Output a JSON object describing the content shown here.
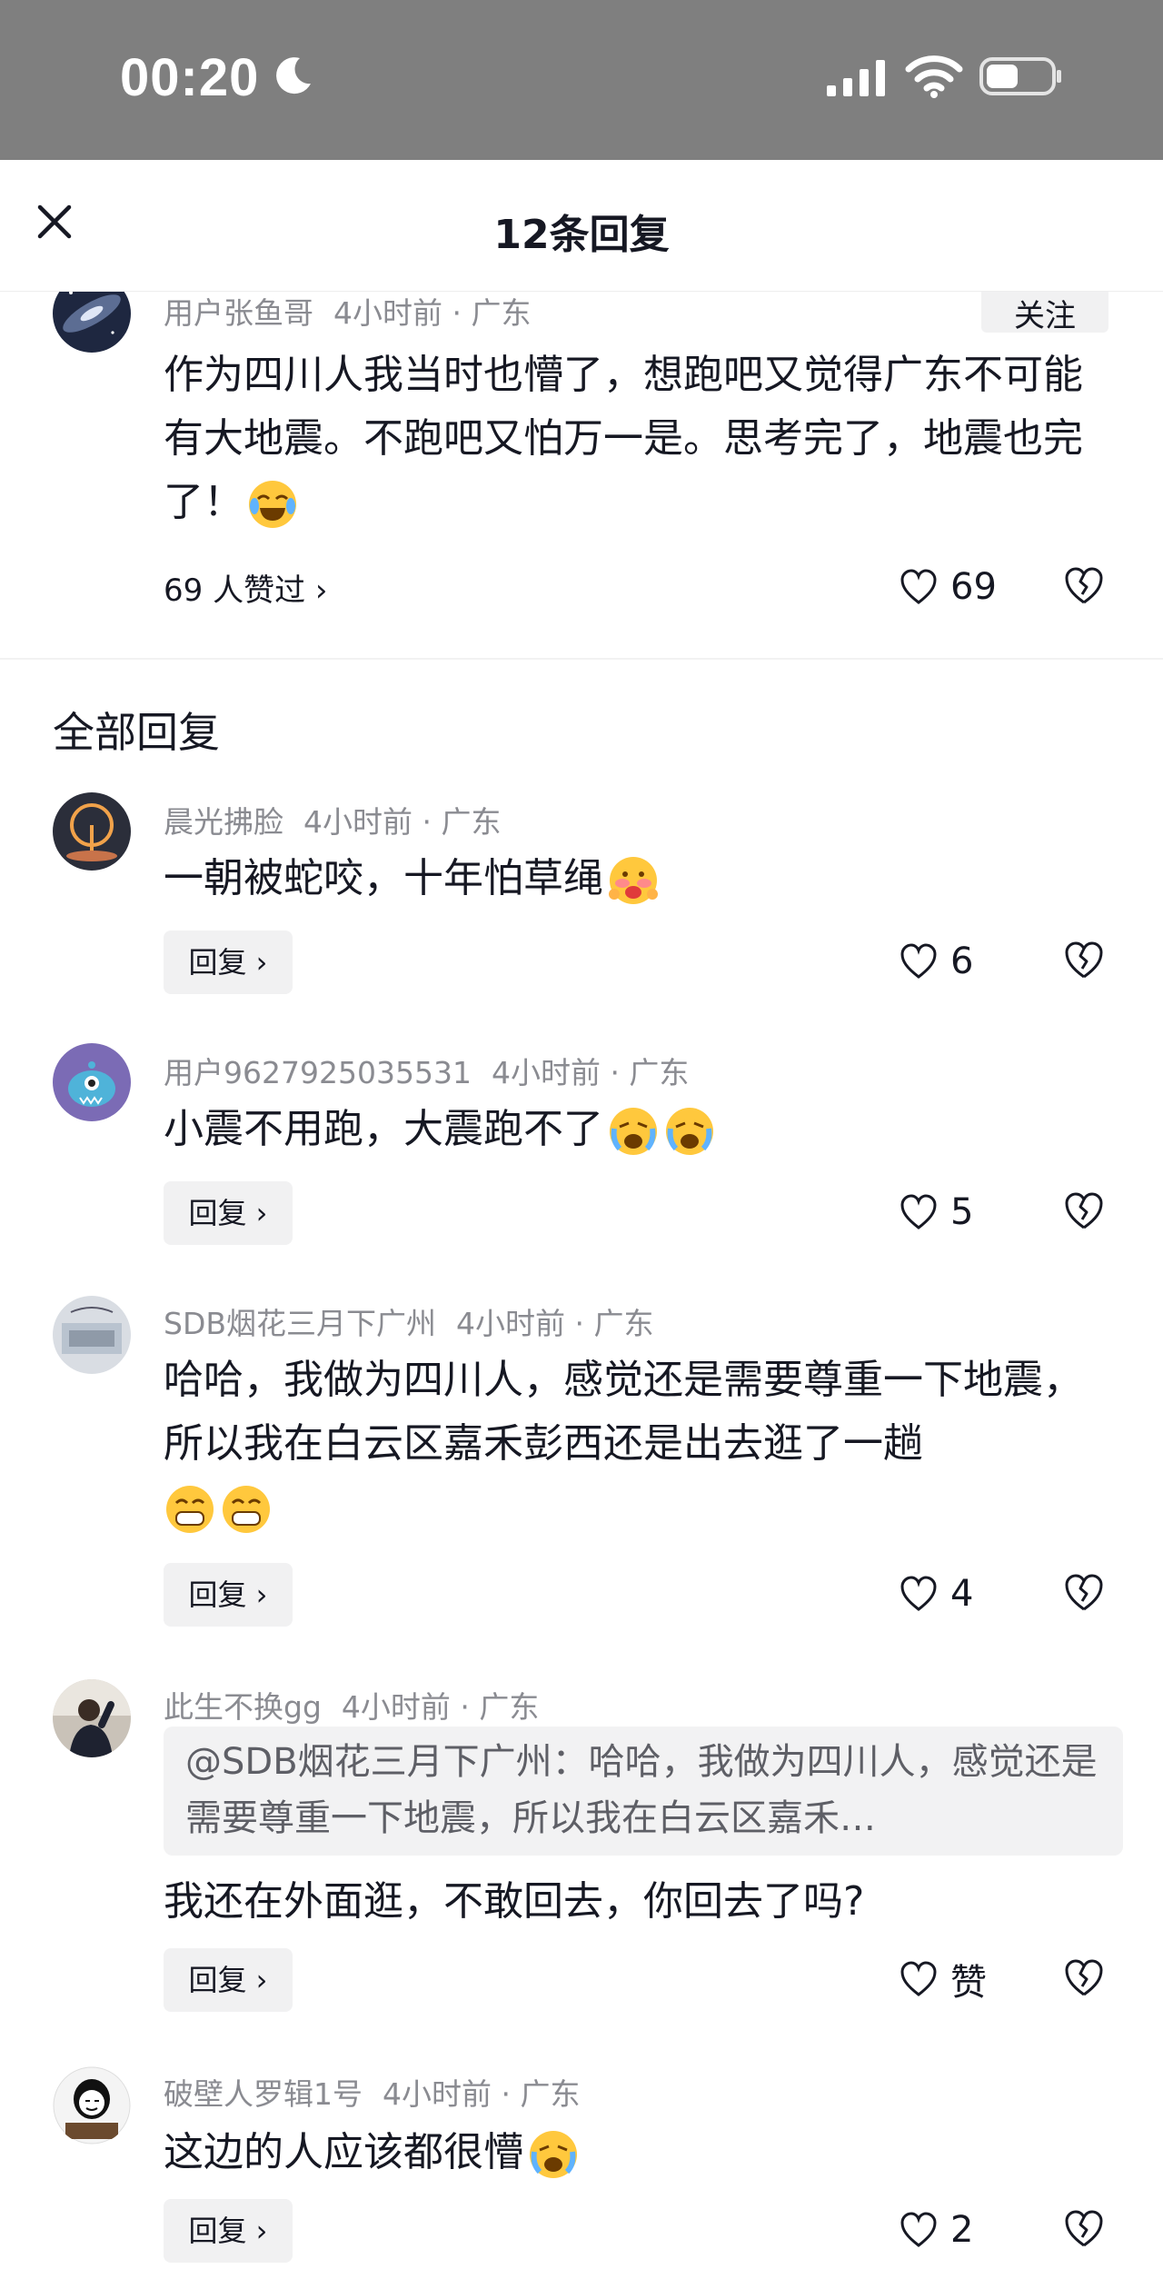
{
  "status_bar": {
    "time": "00:20"
  },
  "header": {
    "title": "12条回复",
    "close_icon": "close-icon"
  },
  "parent_comment": {
    "user": "用户张鱼哥",
    "time": "4小时前 · 广东",
    "follow_label": "关注",
    "text": "作为四川人我当时也懵了，想跑吧又觉得广东不可能有大地震。不跑吧又怕万一是。思考完了，地震也完了！",
    "likes_link": "69 人赞过 ›",
    "like_count": "69"
  },
  "section_title": "全部回复",
  "replies": [
    {
      "user": "晨光拂脸",
      "time": "4小时前 · 广东",
      "text": "一朝被蛇咬，十年怕草绳",
      "reply_label": "回复 ›",
      "like_count": "6"
    },
    {
      "user": "用户9627925035531",
      "time": "4小时前 · 广东",
      "text": "小震不用跑，大震跑不了",
      "reply_label": "回复 ›",
      "like_count": "5"
    },
    {
      "user": "SDB烟花三月下广州",
      "time": "4小时前 · 广东",
      "text": "哈哈，我做为四川人，感觉还是需要尊重一下地震，所以我在白云区嘉禾彭西还是出去逛了一趟",
      "reply_label": "回复 ›",
      "like_count": "4"
    },
    {
      "user": "此生不换gg",
      "time": "4小时前 · 广东",
      "quote": "@SDB烟花三月下广州：哈哈，我做为四川人，感觉还是需要尊重一下地震，所以我在白云区嘉禾…",
      "text": "我还在外面逛，不敢回去，你回去了吗?",
      "reply_label": "回复 ›",
      "like_count": "赞"
    },
    {
      "user": "破壁人罗辑1号",
      "time": "4小时前 · 广东",
      "text": "这边的人应该都很懵",
      "reply_label": "回复 ›",
      "like_count": "2"
    }
  ],
  "colors": {
    "status_bar_bg": "#7f7f7f",
    "meta_gray": "#8a8b91",
    "button_bg": "#f1f1f2"
  }
}
